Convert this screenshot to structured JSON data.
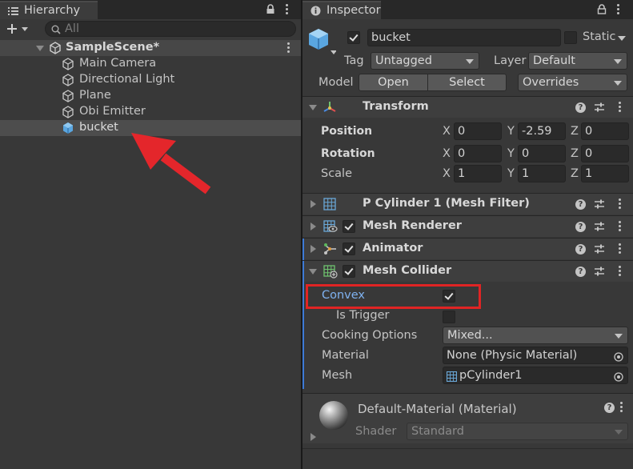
{
  "hierarchy": {
    "tab_label": "Hierarchy",
    "search_placeholder": "All",
    "scene": {
      "name": "SampleScene*"
    },
    "items": [
      {
        "label": "Main Camera"
      },
      {
        "label": "Directional Light"
      },
      {
        "label": "Plane"
      },
      {
        "label": "Obi Emitter"
      },
      {
        "label": "bucket",
        "selected": true
      }
    ]
  },
  "inspector": {
    "tab_label": "Inspector",
    "object": {
      "name": "bucket",
      "active": true,
      "static_label": "Static",
      "tag_label": "Tag",
      "tag_value": "Untagged",
      "layer_label": "Layer",
      "layer_value": "Default",
      "model_label": "Model",
      "open_label": "Open",
      "select_label": "Select",
      "overrides_label": "Overrides"
    },
    "transform": {
      "title": "Transform",
      "position_label": "Position",
      "rotation_label": "Rotation",
      "scale_label": "Scale",
      "x_label": "X",
      "y_label": "Y",
      "z_label": "Z",
      "position": {
        "x": "0",
        "y": "-2.59",
        "z": "0"
      },
      "rotation": {
        "x": "0",
        "y": "0",
        "z": "0"
      },
      "scale": {
        "x": "1",
        "y": "1",
        "z": "1"
      }
    },
    "components": [
      {
        "title": "P Cylinder 1 (Mesh Filter)"
      },
      {
        "title": "Mesh Renderer",
        "enabled": true
      },
      {
        "title": "Animator",
        "enabled": true
      },
      {
        "title": "Mesh Collider",
        "enabled": true
      }
    ],
    "mesh_collider": {
      "convex_label": "Convex",
      "convex": true,
      "is_trigger_label": "Is Trigger",
      "is_trigger": false,
      "cooking_label": "Cooking Options",
      "cooking_value": "Mixed...",
      "material_label": "Material",
      "material_value": "None (Physic Material)",
      "mesh_label": "Mesh",
      "mesh_value": "pCylinder1"
    },
    "material": {
      "title": "Default-Material (Material)",
      "shader_label": "Shader",
      "shader_value": "Standard"
    }
  },
  "colors": {
    "selection": "#4d4d4d",
    "highlight_box": "#e02424",
    "arrow": "#e4262b",
    "convex_label": "#7fb2f0",
    "modified_bar": "#3d7ad6"
  }
}
